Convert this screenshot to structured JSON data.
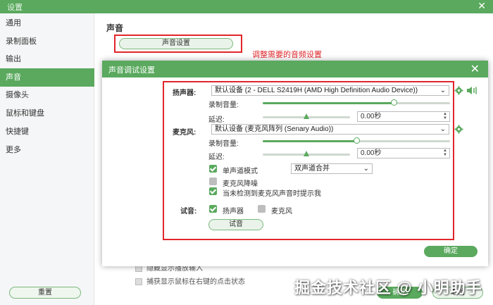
{
  "window": {
    "title": "设置",
    "close_glyph": "✕"
  },
  "sidebar": {
    "items": [
      {
        "label": "通用"
      },
      {
        "label": "录制面板"
      },
      {
        "label": "输出"
      },
      {
        "label": "声音"
      },
      {
        "label": "摄像头"
      },
      {
        "label": "鼠标和键盘"
      },
      {
        "label": "快捷键"
      },
      {
        "label": "更多"
      }
    ],
    "active_index": 3,
    "reset_label": "重置"
  },
  "main": {
    "title": "声音",
    "sound_settings_label": "声音设置",
    "annotation": "调整需要的音频设置",
    "bg_rows": [
      "隐藏显示播放输入",
      "捕获显示鼠标在右键的点击状态"
    ]
  },
  "footer": {
    "ok_label": "确定",
    "cancel_label": "取消"
  },
  "watermark": "掘金技术社区 @ 小明助手",
  "dialog": {
    "title": "声音调试设置",
    "close_glyph": "✕",
    "speaker": {
      "label": "扬声器:",
      "device": "默认设备 (2 - DELL S2419H (AMD High Definition Audio Device))",
      "volume_label": "录制音量:",
      "volume": 0.7,
      "delay_label": "延迟:",
      "delay": 0.5,
      "delay_value": "0.00秒"
    },
    "mic": {
      "label": "麦克风:",
      "device": "默认设备 (麦克风阵列 (Senary Audio))",
      "volume_label": "录制音量:",
      "volume": 0.5,
      "delay_label": "延迟:",
      "delay": 0.5,
      "delay_value": "0.00秒",
      "mono_label": "单声道模式",
      "mono_checked": true,
      "mono_mode": "双声道合并",
      "noise_label": "麦克风降噪",
      "noise_checked": false,
      "prompt_label": "当未检测到麦克风声音时提示我",
      "prompt_checked": true
    },
    "test": {
      "label": "试音:",
      "speaker_label": "扬声器",
      "speaker_checked": true,
      "mic_label": "麦克风",
      "mic_checked": false,
      "button_label": "试音"
    },
    "ok_label": "确定"
  },
  "colors": {
    "accent": "#5aa95e",
    "annotation_red": "#e0262b"
  },
  "icons": [
    "gear-icon",
    "speaker-volume-icon",
    "close-icon",
    "chevron-down-icon"
  ]
}
